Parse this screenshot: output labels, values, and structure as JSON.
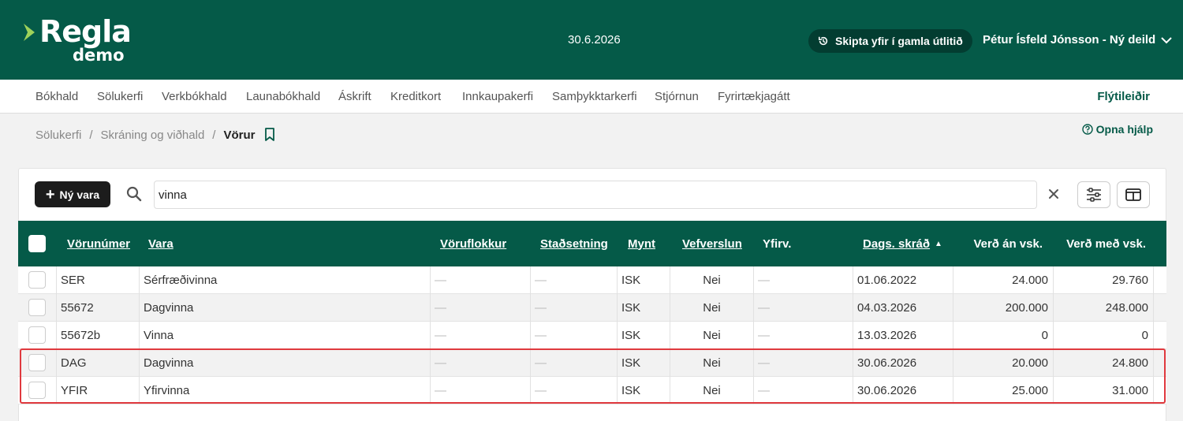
{
  "header": {
    "logo_main": "Regla",
    "logo_sub": "demo",
    "date": "30.6.2026",
    "switch_label": "Skipta yfir í gamla útlitið",
    "user": "Pétur Ísfeld Jónsson - Ný deild"
  },
  "nav": {
    "items": [
      "Bókhald",
      "Sölukerfi",
      "Verkbókhald",
      "Launabókhald",
      "Áskrift",
      "Kreditkort",
      "Innkaupakerfi",
      "Samþykktarkerfi",
      "Stjórnun",
      "Fyrirtækjagátt"
    ],
    "shortcuts": "Flýtileiðir"
  },
  "breadcrumb": {
    "items": [
      "Sölukerfi",
      "Skráning og viðhald",
      "Vörur"
    ],
    "separator": "/"
  },
  "help_label": "Opna hjálp",
  "toolbar": {
    "new_label": "Ný vara",
    "search_value": "vinna"
  },
  "table": {
    "headers": [
      "Vörunúmer",
      "Vara",
      "Vöruflokkur",
      "Staðsetning",
      "Mynt",
      "Vefverslun",
      "Yfirv.",
      "Dags. skráð",
      "Verð án vsk.",
      "Verð með vsk."
    ],
    "sort_indicator": "▲",
    "rows": [
      {
        "nr": "SER",
        "vara": "Sérfræðivinna",
        "flokkur": "—",
        "stadsetning": "—",
        "mynt": "ISK",
        "vefverslun": "Nei",
        "yfirv": "—",
        "dags": "01.06.2022",
        "an_vsk": "24.000",
        "med_vsk": "29.760"
      },
      {
        "nr": "55672",
        "vara": "Dagvinna",
        "flokkur": "—",
        "stadsetning": "—",
        "mynt": "ISK",
        "vefverslun": "Nei",
        "yfirv": "—",
        "dags": "04.03.2026",
        "an_vsk": "200.000",
        "med_vsk": "248.000"
      },
      {
        "nr": "55672b",
        "vara": "Vinna",
        "flokkur": "—",
        "stadsetning": "—",
        "mynt": "ISK",
        "vefverslun": "Nei",
        "yfirv": "—",
        "dags": "13.03.2026",
        "an_vsk": "0",
        "med_vsk": "0"
      },
      {
        "nr": "DAG",
        "vara": "Dagvinna",
        "flokkur": "—",
        "stadsetning": "—",
        "mynt": "ISK",
        "vefverslun": "Nei",
        "yfirv": "—",
        "dags": "30.06.2026",
        "an_vsk": "20.000",
        "med_vsk": "24.800"
      },
      {
        "nr": "YFIR",
        "vara": "Yfirvinna",
        "flokkur": "—",
        "stadsetning": "—",
        "mynt": "ISK",
        "vefverslun": "Nei",
        "yfirv": "—",
        "dags": "30.06.2026",
        "an_vsk": "25.000",
        "med_vsk": "31.000"
      }
    ]
  },
  "colors": {
    "brand": "#055a48",
    "highlight": "#e0393e"
  }
}
